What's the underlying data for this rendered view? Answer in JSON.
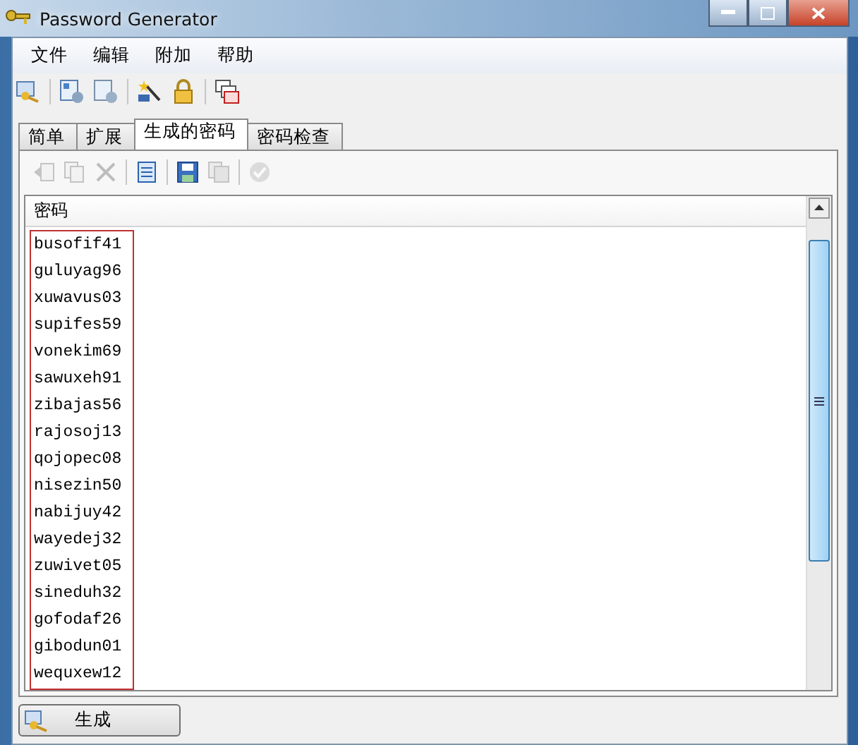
{
  "window": {
    "title": "Password Generator"
  },
  "menu": [
    "文件",
    "编辑",
    "附加",
    "帮助"
  ],
  "tabs": [
    {
      "label": "简单",
      "selected": false
    },
    {
      "label": "扩展",
      "selected": false
    },
    {
      "label": "生成的密码",
      "selected": true
    },
    {
      "label": "密码检查",
      "selected": false
    }
  ],
  "list_toolbar": [
    {
      "disabled": true
    },
    {
      "disabled": true
    },
    {
      "disabled": true
    },
    {
      "disabled": false
    },
    {
      "disabled": false
    },
    {
      "disabled": true
    },
    {
      "disabled": true
    }
  ],
  "list": {
    "column": "密码",
    "rows": [
      "busofif41",
      "guluyag96",
      "xuwavus03",
      "supifes59",
      "vonekim69",
      "sawuxeh91",
      "zibajas56",
      "rajosoj13",
      "qojopec08",
      "nisezin50",
      "nabijuy42",
      "wayedej32",
      "zuwivet05",
      "sineduh32",
      "gofodaf26",
      "gibodun01",
      "wequxew12"
    ]
  },
  "generate_button": "生成"
}
